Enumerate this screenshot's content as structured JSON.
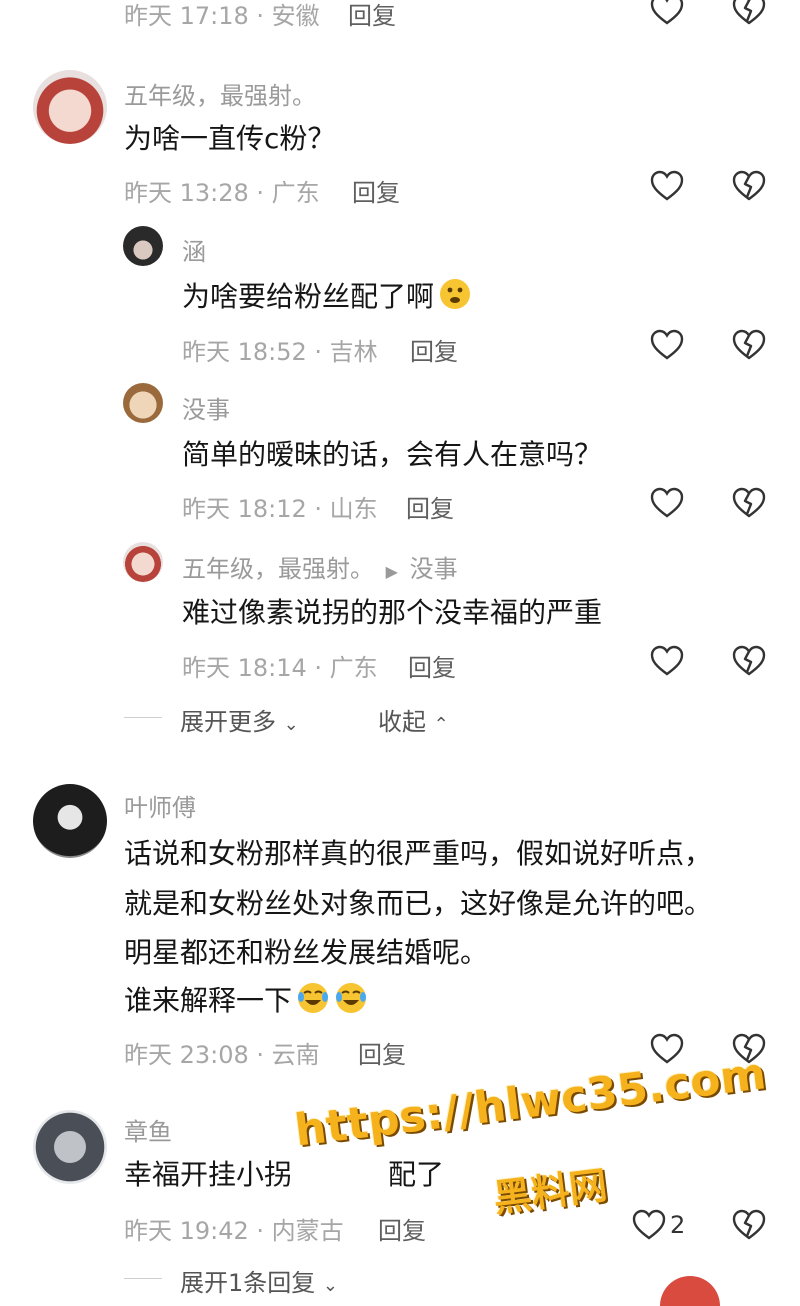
{
  "top_partial": {
    "meta": "昨天 17:18 · 安徽",
    "reply": "回复"
  },
  "comments": [
    {
      "user": "五年级，最强射。",
      "text": "为啥一直传c粉？",
      "meta": "昨天 13:28 · 广东",
      "reply": "回复"
    },
    {
      "user": "涵",
      "text": "为啥要给粉丝配了啊",
      "meta": "昨天 18:52 · 吉林",
      "reply": "回复"
    },
    {
      "user": "没事",
      "text": "简单的暧昧的话，会有人在意吗？",
      "meta": "昨天 18:12 · 山东",
      "reply": "回复"
    },
    {
      "user": "五年级，最强射。",
      "reply_to": "没事",
      "text": "难过像素说拐的那个没幸福的严重",
      "meta": "昨天 18:14 · 广东",
      "reply": "回复"
    },
    {
      "user": "叶师傅",
      "lines": [
        "话说和女粉那样真的很严重吗，假如说好听点，",
        "就是和女粉丝处对象而已，这好像是允许的吧。",
        "明星都还和粉丝发展结婚呢。",
        "谁来解释一下"
      ],
      "meta": "昨天 23:08 · 云南",
      "reply": "回复"
    },
    {
      "user": "章鱼",
      "text": "幸福开挂小拐",
      "text_tail": "配了",
      "meta": "昨天 19:42 · 内蒙古",
      "reply": "回复",
      "like_count": "2"
    }
  ],
  "thread_controls": {
    "expand_more": "展开更多",
    "collapse": "收起"
  },
  "bottom_expand": "展开1条回复",
  "watermark": {
    "url": "https://hlwc35.com",
    "site": "黑料网"
  },
  "colors": {
    "text": "#161616",
    "meta": "#a6a6a6",
    "watermark": "#f5b21d"
  }
}
